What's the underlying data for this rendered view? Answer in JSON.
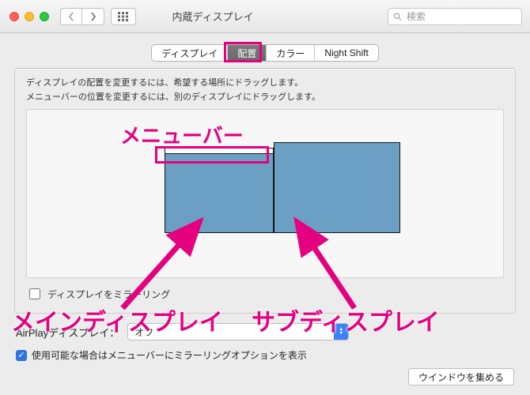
{
  "colors": {
    "accent": "#e5007f",
    "display_fill": "#6b9fc4",
    "selection": "#3b82f6"
  },
  "window": {
    "title": "内蔵ディスプレイ",
    "search_placeholder": "検索"
  },
  "tabs": {
    "items": [
      "ディスプレイ",
      "配置",
      "カラー",
      "Night Shift"
    ],
    "active_index": 1
  },
  "panel": {
    "hint_line1": "ディスプレイの配置を変更するには、希望する場所にドラッグします。",
    "hint_line2": "メニューバーの位置を変更するには、別のディスプレイにドラッグします。",
    "mirror_label": "ディスプレイをミラーリング",
    "mirror_checked": false
  },
  "airplay": {
    "label": "AirPlayディスプレイ：",
    "selected": "オフ"
  },
  "show_mirror_option": {
    "checked": true,
    "label": "使用可能な場合はメニューバーにミラーリングオプションを表示"
  },
  "gather_button": "ウインドウを集める",
  "annotations": {
    "menubar": "メニューバー",
    "main_display": "メインディスプレイ",
    "sub_display": "サブディスプレイ"
  }
}
